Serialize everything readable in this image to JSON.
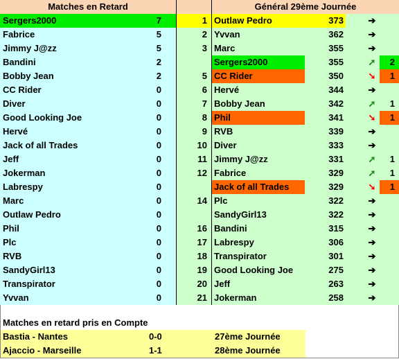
{
  "late_table": {
    "title": "Matches en Retard",
    "rows": [
      {
        "name": "Sergers2000",
        "value": "7",
        "highlight": "#00ee00"
      },
      {
        "name": "Fabrice",
        "value": "5"
      },
      {
        "name": "Jimmy J@zz",
        "value": "5"
      },
      {
        "name": "Bandini",
        "value": "2"
      },
      {
        "name": "Bobby Jean",
        "value": "2"
      },
      {
        "name": "CC Rider",
        "value": "0"
      },
      {
        "name": "Diver",
        "value": "0"
      },
      {
        "name": "Good Looking Joe",
        "value": "0"
      },
      {
        "name": "Hervé",
        "value": "0"
      },
      {
        "name": "Jack of all Trades",
        "value": "0"
      },
      {
        "name": "Jeff",
        "value": "0"
      },
      {
        "name": "Jokerman",
        "value": "0"
      },
      {
        "name": "Labrespy",
        "value": "0"
      },
      {
        "name": "Marc",
        "value": "0"
      },
      {
        "name": "Outlaw Pedro",
        "value": "0"
      },
      {
        "name": "Phil",
        "value": "0"
      },
      {
        "name": "Plc",
        "value": "0"
      },
      {
        "name": "RVB",
        "value": "0"
      },
      {
        "name": "SandyGirl13",
        "value": "0"
      },
      {
        "name": "Transpirator",
        "value": "0"
      },
      {
        "name": "Yvvan",
        "value": "0"
      }
    ]
  },
  "general_table": {
    "title": "Général 29ème Journée",
    "rows": [
      {
        "rank": "1",
        "name": "Outlaw Pedro",
        "score": "373",
        "trend": "flat",
        "change": "",
        "highlight": "#ffff00"
      },
      {
        "rank": "2",
        "name": "Yvvan",
        "score": "362",
        "trend": "flat",
        "change": ""
      },
      {
        "rank": "3",
        "name": "Marc",
        "score": "355",
        "trend": "flat",
        "change": ""
      },
      {
        "rank": "",
        "name": "Sergers2000",
        "score": "355",
        "trend": "up",
        "change": "2",
        "highlight": "#00ee00"
      },
      {
        "rank": "5",
        "name": "CC Rider",
        "score": "350",
        "trend": "down",
        "change": "1",
        "highlight": "#ff6600"
      },
      {
        "rank": "6",
        "name": "Hervé",
        "score": "344",
        "trend": "flat",
        "change": ""
      },
      {
        "rank": "7",
        "name": "Bobby Jean",
        "score": "342",
        "trend": "up",
        "change": "1"
      },
      {
        "rank": "8",
        "name": "Phil",
        "score": "341",
        "trend": "down",
        "change": "1",
        "highlight": "#ff6600"
      },
      {
        "rank": "9",
        "name": "RVB",
        "score": "339",
        "trend": "flat",
        "change": ""
      },
      {
        "rank": "10",
        "name": "Diver",
        "score": "333",
        "trend": "flat",
        "change": ""
      },
      {
        "rank": "11",
        "name": "Jimmy J@zz",
        "score": "331",
        "trend": "up",
        "change": "1"
      },
      {
        "rank": "12",
        "name": "Fabrice",
        "score": "329",
        "trend": "up",
        "change": "1"
      },
      {
        "rank": "",
        "name": "Jack of all Trades",
        "score": "329",
        "trend": "down",
        "change": "1",
        "highlight": "#ff6600"
      },
      {
        "rank": "14",
        "name": "Plc",
        "score": "322",
        "trend": "flat",
        "change": ""
      },
      {
        "rank": "",
        "name": "SandyGirl13",
        "score": "322",
        "trend": "flat",
        "change": ""
      },
      {
        "rank": "16",
        "name": "Bandini",
        "score": "315",
        "trend": "flat",
        "change": ""
      },
      {
        "rank": "17",
        "name": "Labrespy",
        "score": "306",
        "trend": "flat",
        "change": ""
      },
      {
        "rank": "18",
        "name": "Transpirator",
        "score": "301",
        "trend": "flat",
        "change": ""
      },
      {
        "rank": "19",
        "name": "Good Looking Joe",
        "score": "275",
        "trend": "flat",
        "change": ""
      },
      {
        "rank": "20",
        "name": "Jeff",
        "score": "263",
        "trend": "flat",
        "change": ""
      },
      {
        "rank": "21",
        "name": "Jokerman",
        "score": "258",
        "trend": "flat",
        "change": ""
      }
    ],
    "icons": {
      "flat": "➔",
      "up": "➚",
      "down": "➘"
    }
  },
  "footer": {
    "title": "Matches en retard pris en Compte",
    "matches": [
      {
        "match": "Bastia - Nantes",
        "score": "0-0",
        "round": "27ème Journée"
      },
      {
        "match": "Ajaccio - Marseille",
        "score": "1-1",
        "round": "28ème Journée"
      }
    ],
    "bg": "#ffff99"
  }
}
